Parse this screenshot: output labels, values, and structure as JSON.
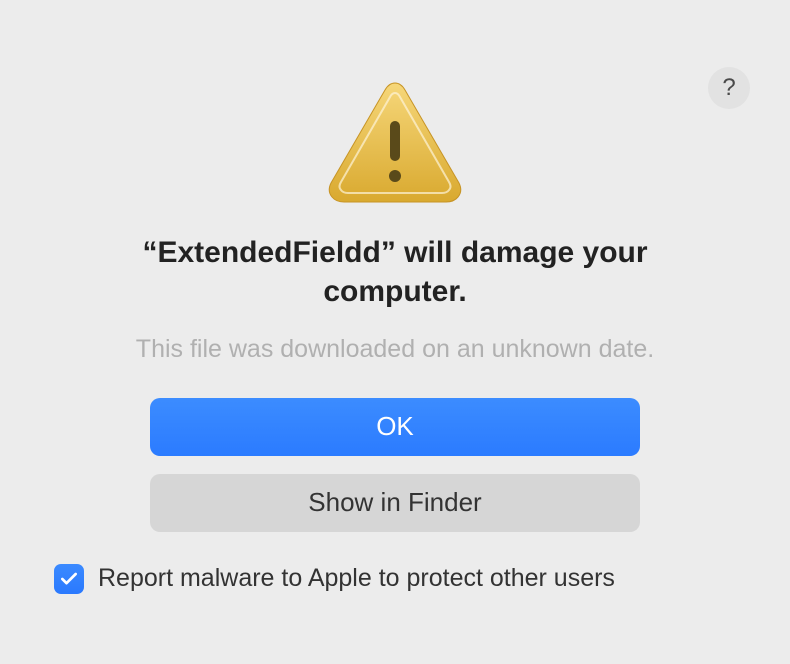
{
  "headline": "“ExtendedFieldd” will damage your computer.",
  "subtext": "This file was downloaded on an unknown date.",
  "buttons": {
    "primary": "OK",
    "secondary": "Show in Finder"
  },
  "checkbox": {
    "label": "Report malware to Apple to protect other users",
    "checked": true
  },
  "help_label": "?"
}
